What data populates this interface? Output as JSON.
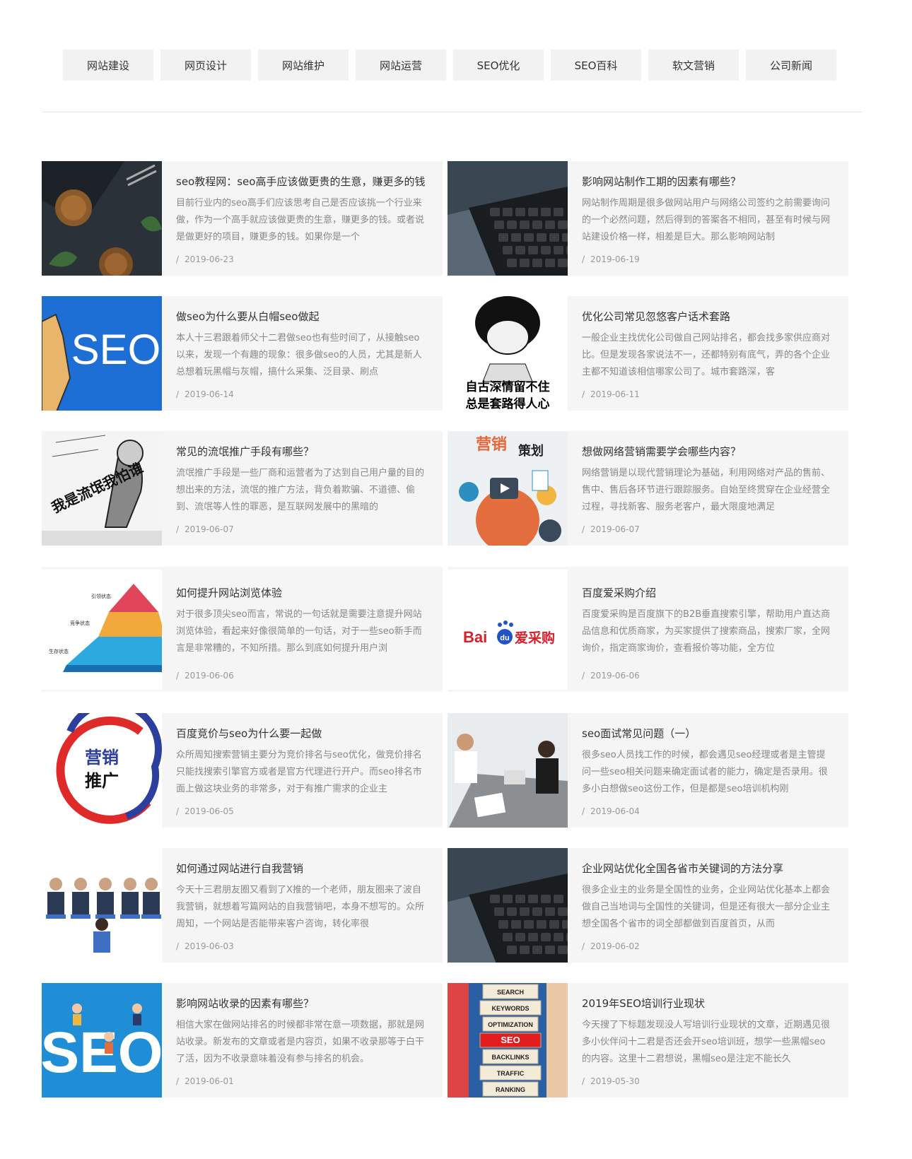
{
  "nav": [
    "网站建设",
    "网页设计",
    "网站维护",
    "网站运营",
    "SEO优化",
    "SEO百科",
    "软文营销",
    "公司新闻"
  ],
  "articles": [
    {
      "title": "seo教程网：seo高手应该做更贵的生意，赚更多的钱",
      "desc": "目前行业内的seo高手们应该思考自己是否应该挑一个行业来做，作为一个高手就应该做更贵的生意，赚更多的钱。或者说是做更好的项目，赚更多的钱。如果你是一个",
      "date": "2019-06-23",
      "thumb": "food"
    },
    {
      "title": "影响网站制作工期的因素有哪些？",
      "desc": "网站制作周期是很多做网站用户与网络公司签约之前需要询问的一个必然问题，然后得到的答案各不相同，甚至有时候与网站建设价格一样，相差是巨大。那么影响网站制",
      "date": "2019-06-19",
      "thumb": "laptop"
    },
    {
      "title": "做seo为什么要从白帽seo做起",
      "desc": "本人十三君跟着师父十二君做seo也有些时间了，从接触seo以来，发现一个有趣的现象：很多做seo的人员，尤其是新人总想着玩黑帽与灰帽，搞什么采集、泛目录、刷点",
      "date": "2019-06-14",
      "thumb": "seo-hand"
    },
    {
      "title": "优化公司常见忽悠客户话术套路",
      "desc": "一般企业主找优化公司做自己网站排名，都会找多家供应商对比。但是发现各家说法不一，还都特别有底气，弄的各个企业主都不知道该相信哪家公司了。城市套路深，客",
      "date": "2019-06-11",
      "thumb": "meme"
    },
    {
      "title": "常见的流氓推广手段有哪些？",
      "desc": "流氓推广手段是一些厂商和运营者为了达到自己用户量的目的想出来的方法，流氓的推广方法，背负着欺骗、不道德、偷到、流氓等人性的罪恶，是互联网发展中的黑暗的",
      "date": "2019-06-07",
      "thumb": "cartoon"
    },
    {
      "title": "想做网络营销需要学会哪些内容？",
      "desc": "网络营销是以现代营销理论为基础，利用网络对产品的售前、售中、售后各环节进行跟踪服务。自始至终贯穿在企业经营全过程，寻找新客、服务老客户，最大限度地满足",
      "date": "2019-06-07",
      "thumb": "marketing"
    },
    {
      "title": "如何提升网站浏览体验",
      "desc": "对于很多顶尖seo而言，常说的一句话就是需要注意提升网站浏览体验，看起来好像很简单的一句话，对于一些seo新手而言是非常糟的，不知所措。那么到底如何提升用户浏",
      "date": "2019-06-06",
      "thumb": "pyramid"
    },
    {
      "title": "百度爱采购介绍",
      "desc": "百度爱采购是百度旗下的B2B垂直搜索引擎，帮助用户直达商品信息和优质商家，为买家提供了搜索商品，搜索厂家，全网询价，指定商家询价，查看报价等功能，全方位",
      "date": "2019-06-06",
      "thumb": "baidu"
    },
    {
      "title": "百度竞价与seo为什么要一起做",
      "desc": "众所周知搜索营销主要分为竞价排名与seo优化，做竞价排名只能找搜索引擎官方或者是官方代理进行开户。而seo排名市面上做这块业务的非常多，对于有推广需求的企业主",
      "date": "2019-06-05",
      "thumb": "promo"
    },
    {
      "title": "seo面试常见问题（一）",
      "desc": "很多seo人员找工作的时候，都会遇见seo经理或者是主管提问一些seo相关问题来确定面试者的能力，确定是否录用。很多小白想做seo这份工作，但是都是seo培训机构刚",
      "date": "2019-06-04",
      "thumb": "interview"
    },
    {
      "title": "如何通过网站进行自我营销",
      "desc": "今天十三君朋友圈又看到了X推的一个老师，朋友圈来了波自我营销，就想着写篇网站的自我营销吧，本身不想写的。众所周知，一个网站是否能带来客户咨询，转化率很",
      "date": "2019-06-03",
      "thumb": "meeting"
    },
    {
      "title": "企业网站优化全国各省市关键词的方法分享",
      "desc": "很多企业主的业务是全国性的业务，企业网站优化基本上都会做自己当地词与全国性的关键词，但是还有很大一部分企业主想全国各个省市的词全部都做到百度首页，从而",
      "date": "2019-06-02",
      "thumb": "laptop"
    },
    {
      "title": "影响网站收录的因素有哪些？",
      "desc": "相信大家在做网站排名的时候都非常在意一项数据，那就是网站收录。新发布的文章或者是内容页，如果不收录那等于白干了活，因为不收录意味着没有参与排名的机会。",
      "date": "2019-06-01",
      "thumb": "seo-people"
    },
    {
      "title": "2019年SEO培训行业现状",
      "desc": "今天搜了下标题发现没人写培训行业现状的文章，近期遇见很多小伙伴问十二君是否还会开seo培训班，想学一些黑帽seo的内容。这里十二君想说，黑帽seo是注定不能长久",
      "date": "2019-05-30",
      "thumb": "blocks"
    }
  ],
  "thumb_text": {
    "seo": "SEO",
    "meme_line1": "自古深情留不住",
    "meme_line2": "总是套路得人心",
    "cartoon_text": "我是流氓我怕谁",
    "marketing_a": "营销",
    "marketing_b": "策划",
    "baidu_a": "Bai",
    "baidu_b": "du",
    "baidu_c": "爱采购",
    "promo_a": "营销",
    "promo_b": "推广",
    "blocks": [
      "SEARCH",
      "KEYWORDS",
      "OPTIMIZATION",
      "SEO",
      "BACKLINKS",
      "TRAFFIC",
      "RANKING"
    ],
    "pyramid_labels": [
      "引领状态",
      "竞争状态",
      "生存状态"
    ]
  },
  "date_prefix": "/"
}
